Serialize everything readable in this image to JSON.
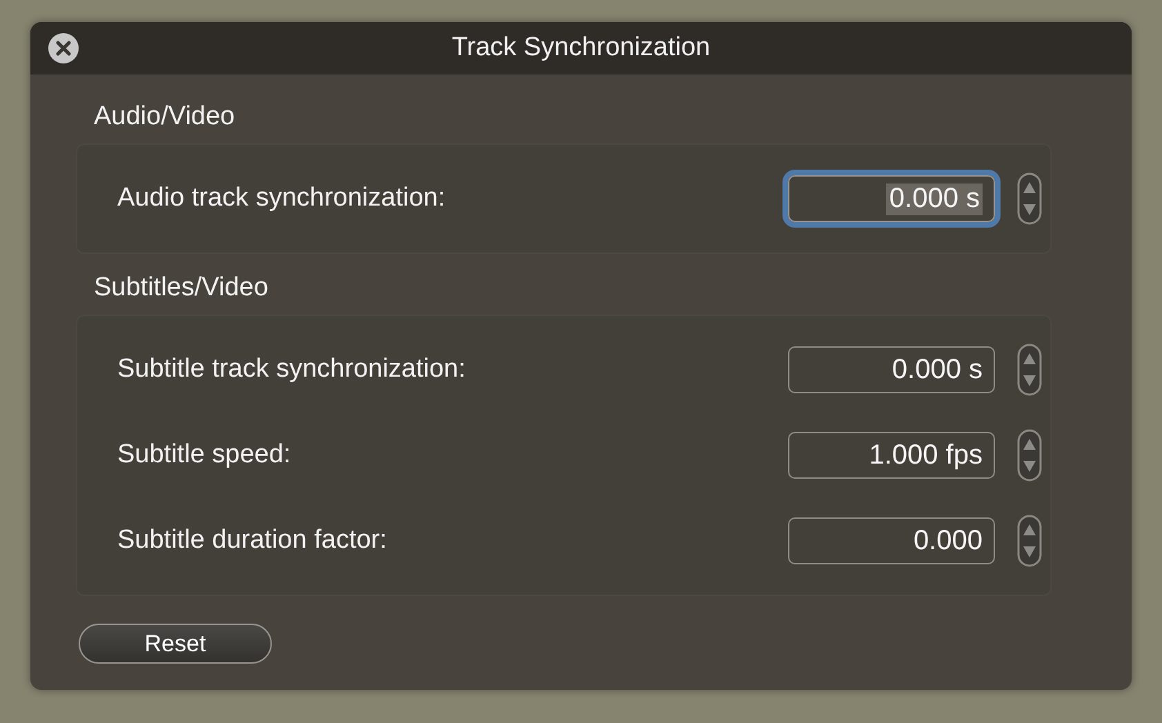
{
  "window": {
    "title": "Track Synchronization"
  },
  "sections": [
    {
      "heading": "Audio/Video",
      "rows": [
        {
          "label": "Audio track synchronization:",
          "value": "0.000 s",
          "focused": true
        }
      ]
    },
    {
      "heading": "Subtitles/Video",
      "rows": [
        {
          "label": "Subtitle track synchronization:",
          "value": "0.000 s",
          "focused": false
        },
        {
          "label": "Subtitle speed:",
          "value": "1.000 fps",
          "focused": false
        },
        {
          "label": "Subtitle duration factor:",
          "value": "0.000",
          "focused": false
        }
      ]
    }
  ],
  "buttons": [
    "Reset"
  ]
}
